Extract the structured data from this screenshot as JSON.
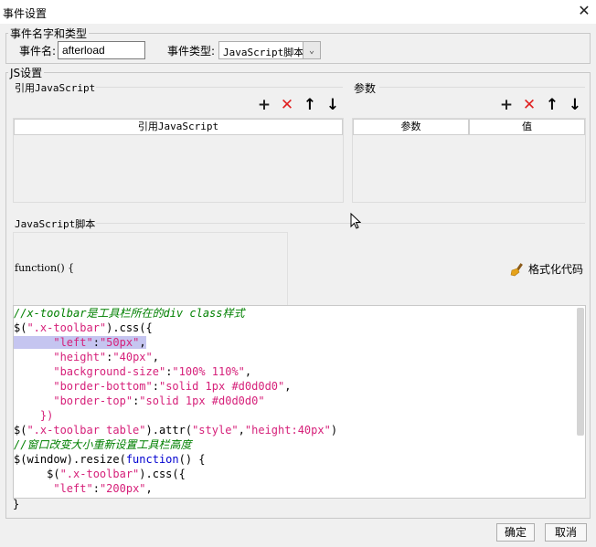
{
  "window": {
    "title": "事件设置",
    "close_icon": "close-icon"
  },
  "event_group": {
    "legend": "事件名字和类型",
    "name_label": "事件名:",
    "name_value": "afterload",
    "type_label": "事件类型:",
    "type_value": "JavaScript脚本"
  },
  "js_group": {
    "legend": "JS设置",
    "ref_section": {
      "title": "引用JavaScript",
      "column": "引用JavaScript",
      "toolbar": [
        "add-icon",
        "delete-icon",
        "move-up-icon",
        "move-down-icon"
      ]
    },
    "param_section": {
      "title": "参数",
      "columns": [
        "参数",
        "值"
      ],
      "toolbar": [
        "add-icon",
        "delete-icon",
        "move-up-icon",
        "move-down-icon"
      ]
    },
    "script_section": {
      "title": "JavaScript脚本",
      "function_header": "function() {",
      "format_button": "格式化代码",
      "closing_brace": "}",
      "code_lines": [
        [
          {
            "t": "//x-toolbar是工具栏所在的div class样式",
            "c": "com"
          }
        ],
        [
          {
            "t": "$(",
            "c": "def"
          },
          {
            "t": "\".x-toolbar\"",
            "c": "str"
          },
          {
            "t": ").css({",
            "c": "def"
          }
        ],
        [
          {
            "t": "      ",
            "c": "sel"
          },
          {
            "t": "\"left\"",
            "c": "str sel"
          },
          {
            "t": ":",
            "c": "def sel"
          },
          {
            "t": "\"50px\"",
            "c": "str sel"
          },
          {
            "t": ",",
            "c": "def sel"
          }
        ],
        [
          {
            "t": "      ",
            "c": "def"
          },
          {
            "t": "\"height\"",
            "c": "str"
          },
          {
            "t": ":",
            "c": "def"
          },
          {
            "t": "\"40px\"",
            "c": "str"
          },
          {
            "t": ",",
            "c": "def"
          }
        ],
        [
          {
            "t": "      ",
            "c": "def"
          },
          {
            "t": "\"background-size\"",
            "c": "str"
          },
          {
            "t": ":",
            "c": "def"
          },
          {
            "t": "\"100% 110%\"",
            "c": "str"
          },
          {
            "t": ",",
            "c": "def"
          }
        ],
        [
          {
            "t": "      ",
            "c": "def"
          },
          {
            "t": "\"border-bottom\"",
            "c": "str"
          },
          {
            "t": ":",
            "c": "def"
          },
          {
            "t": "\"solid 1px #d0d0d0\"",
            "c": "str"
          },
          {
            "t": ",",
            "c": "def"
          }
        ],
        [
          {
            "t": "      ",
            "c": "def"
          },
          {
            "t": "\"border-top\"",
            "c": "str"
          },
          {
            "t": ":",
            "c": "def"
          },
          {
            "t": "\"solid 1px #d0d0d0\"",
            "c": "str"
          }
        ],
        [
          {
            "t": "    })",
            "c": "str"
          }
        ],
        [
          {
            "t": "$(",
            "c": "def"
          },
          {
            "t": "\".x-toolbar table\"",
            "c": "str"
          },
          {
            "t": ").attr(",
            "c": "def"
          },
          {
            "t": "\"style\"",
            "c": "str"
          },
          {
            "t": ",",
            "c": "def"
          },
          {
            "t": "\"height:40px\"",
            "c": "str"
          },
          {
            "t": ")",
            "c": "def"
          }
        ],
        [
          {
            "t": "//窗口改变大小重新设置工具栏高度",
            "c": "com"
          }
        ],
        [
          {
            "t": "$(window).resize(",
            "c": "def"
          },
          {
            "t": "function",
            "c": "kw"
          },
          {
            "t": "() {",
            "c": "def"
          }
        ],
        [
          {
            "t": "     $(",
            "c": "def"
          },
          {
            "t": "\".x-toolbar\"",
            "c": "str"
          },
          {
            "t": ").css({",
            "c": "def"
          }
        ],
        [
          {
            "t": "      ",
            "c": "def"
          },
          {
            "t": "\"left\"",
            "c": "str"
          },
          {
            "t": ":",
            "c": "def"
          },
          {
            "t": "\"200px\"",
            "c": "str"
          },
          {
            "t": ",",
            "c": "def"
          }
        ]
      ]
    }
  },
  "footer": {
    "ok": "确定",
    "cancel": "取消"
  },
  "colors": {
    "add": "#222222",
    "delete": "#e02020",
    "string": "#d6217a",
    "comment": "#008000",
    "keyword": "#0000d0",
    "selection": "#c5c5f0"
  }
}
